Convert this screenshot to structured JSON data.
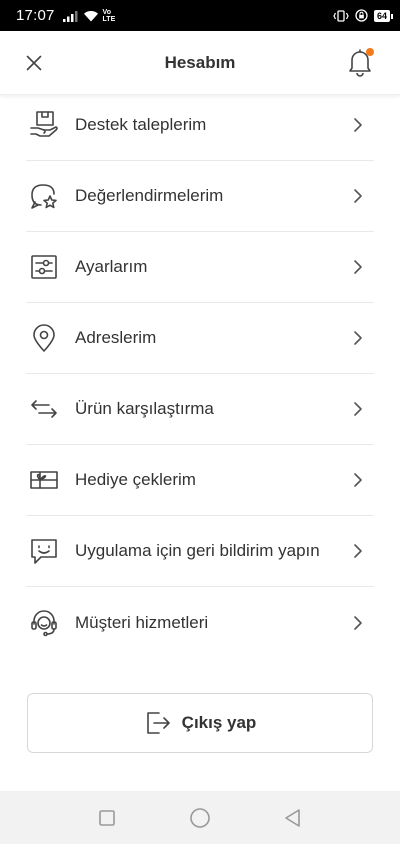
{
  "status_bar": {
    "time": "17:07",
    "volte_top": "Vo",
    "volte_bottom": "LTE",
    "battery": "64"
  },
  "header": {
    "title": "Hesabım",
    "has_notification": true
  },
  "menu": {
    "items": [
      {
        "label": "Destek taleplerim",
        "icon": "support-box-hand-icon"
      },
      {
        "label": "Değerlendirmelerim",
        "icon": "review-star-bubble-icon"
      },
      {
        "label": "Ayarlarım",
        "icon": "settings-sliders-icon"
      },
      {
        "label": "Adreslerim",
        "icon": "location-pin-icon"
      },
      {
        "label": "Ürün karşılaştırma",
        "icon": "compare-arrows-icon"
      },
      {
        "label": "Hediye çeklerim",
        "icon": "gift-voucher-icon"
      },
      {
        "label": "Uygulama için geri bildirim yapın",
        "icon": "feedback-smile-icon"
      },
      {
        "label": "Müşteri hizmetleri",
        "icon": "headset-icon"
      }
    ]
  },
  "logout": {
    "label": "Çıkış yap",
    "icon": "logout-icon"
  },
  "colors": {
    "accent": "#f27a1a",
    "text": "#333333",
    "divider": "#e8e8e8",
    "nav_bg": "#f2f2f2"
  }
}
